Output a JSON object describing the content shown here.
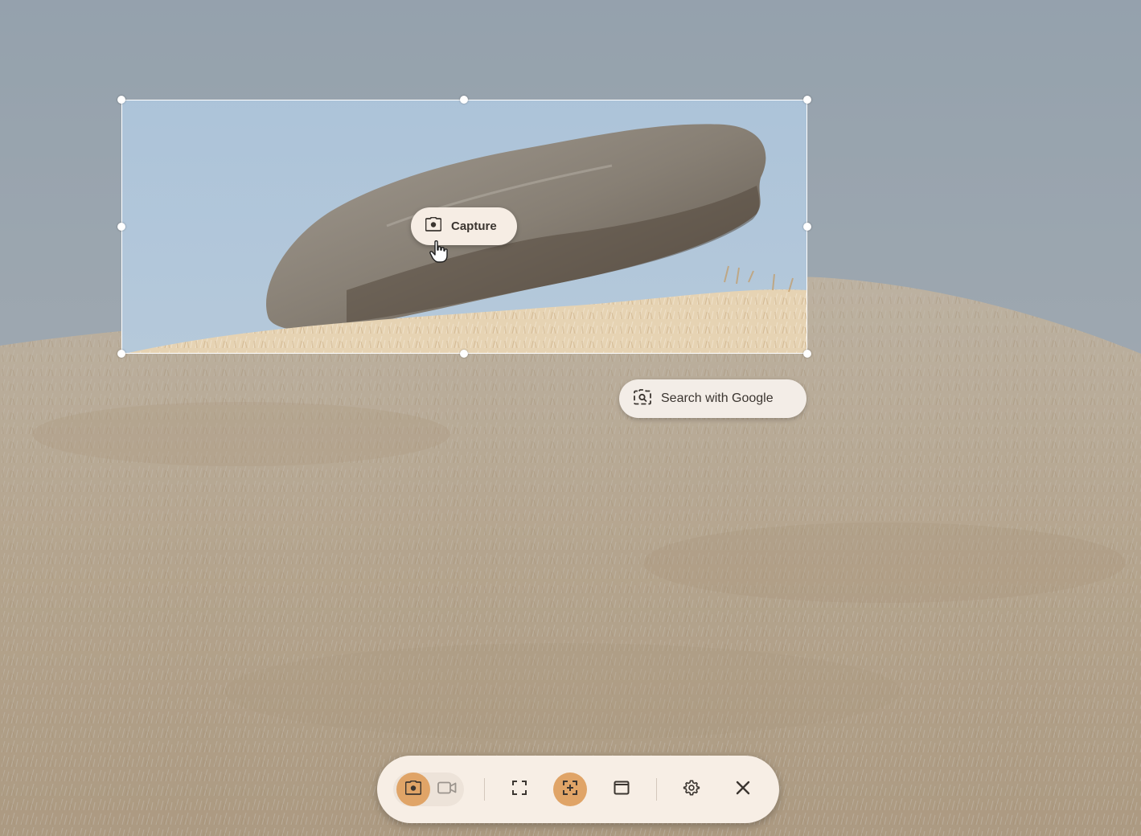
{
  "selection": {
    "capture_label": "Capture"
  },
  "search_pill": {
    "label": "Search with Google"
  },
  "toolbar": {
    "modes": [
      {
        "icon": "camera-icon",
        "active": true
      },
      {
        "icon": "video-camera-icon",
        "active": false
      }
    ],
    "regions": [
      {
        "icon": "fullscreen-capture-icon",
        "active": false
      },
      {
        "icon": "partial-capture-icon",
        "active": true
      },
      {
        "icon": "window-capture-icon",
        "active": false
      }
    ],
    "settings_icon": "gear-icon",
    "close_icon": "close-icon"
  },
  "colors": {
    "accent": "#e0a467",
    "pill_background": "#f6ede4",
    "toolbar_background": "#f7eee5",
    "icon_dark": "#3b3530"
  }
}
